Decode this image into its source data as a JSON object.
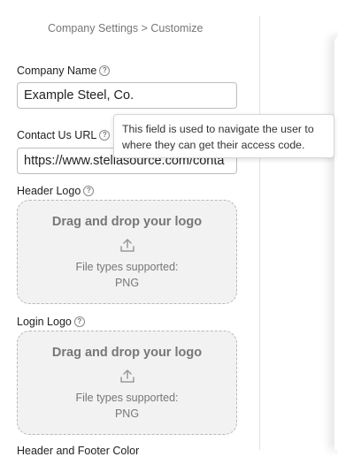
{
  "breadcrumb": "Company Settings > Customize",
  "company_name": {
    "label": "Company Name",
    "value": "Example Steel, Co."
  },
  "contact_url": {
    "label": "Contact Us URL",
    "value": "https://www.stellasource.com/conta"
  },
  "tooltip": "This field is used to navigate the user to where they can get their access code.",
  "header_logo": {
    "label": "Header Logo",
    "drop_title": "Drag and drop your logo",
    "types_label": "File types supported:",
    "types": "PNG"
  },
  "login_logo": {
    "label": "Login Logo",
    "drop_title": "Drag and drop your logo",
    "types_label": "File types supported:",
    "types": "PNG"
  },
  "next_section_label": "Header and Footer Color",
  "icons": {
    "help": "help-circle-icon",
    "upload": "upload-icon"
  },
  "colors": {
    "dropzone_bg": "#f2f2f2",
    "border": "#bdbdbd",
    "muted_text": "#777777"
  }
}
